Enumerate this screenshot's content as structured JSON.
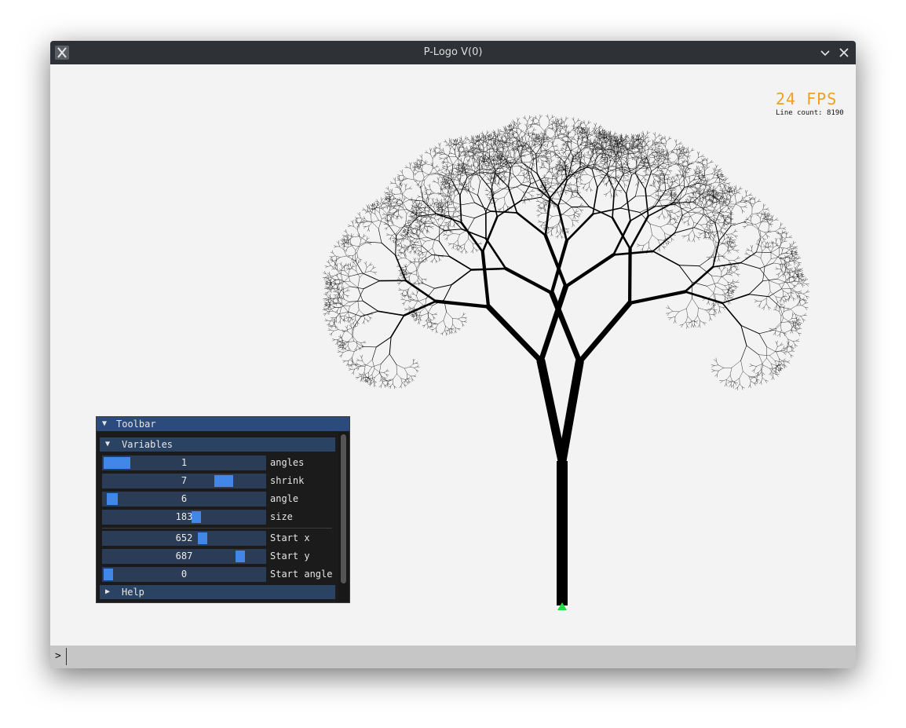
{
  "window": {
    "title": "P-Logo V(0)"
  },
  "stats": {
    "fps": "24 FPS",
    "line_count": "Line count: 8190"
  },
  "toolbar": {
    "title": "Toolbar",
    "expanded_glyph": "▼",
    "collapsed_glyph": "▶",
    "variables_section": "Variables",
    "help_section": "Help",
    "sliders": [
      {
        "label": "angles",
        "value": "1",
        "level": 0.0
      },
      {
        "label": "shrink",
        "value": "7",
        "level": 0.78
      },
      {
        "label": "angle",
        "value": "6",
        "level": 0.02
      },
      {
        "label": "size",
        "value": "183",
        "level": 0.58
      },
      {
        "label": "Start x",
        "value": "652",
        "level": 0.62
      },
      {
        "label": "Start y",
        "value": "687",
        "level": 0.87
      },
      {
        "label": "Start angle",
        "value": "0",
        "level": 0.0
      }
    ]
  },
  "console": {
    "prompt": ">",
    "value": ""
  },
  "colors": {
    "accent": "#4286e8",
    "fps": "#f0a020",
    "turtle": "#22dd44",
    "tree": "#000000",
    "panel_header": "#2b4b7c"
  },
  "icons": {
    "app": "x-logo-icon",
    "minimize": "chevron-down-icon",
    "close": "close-icon",
    "turtle": "turtle-triangle-icon"
  }
}
